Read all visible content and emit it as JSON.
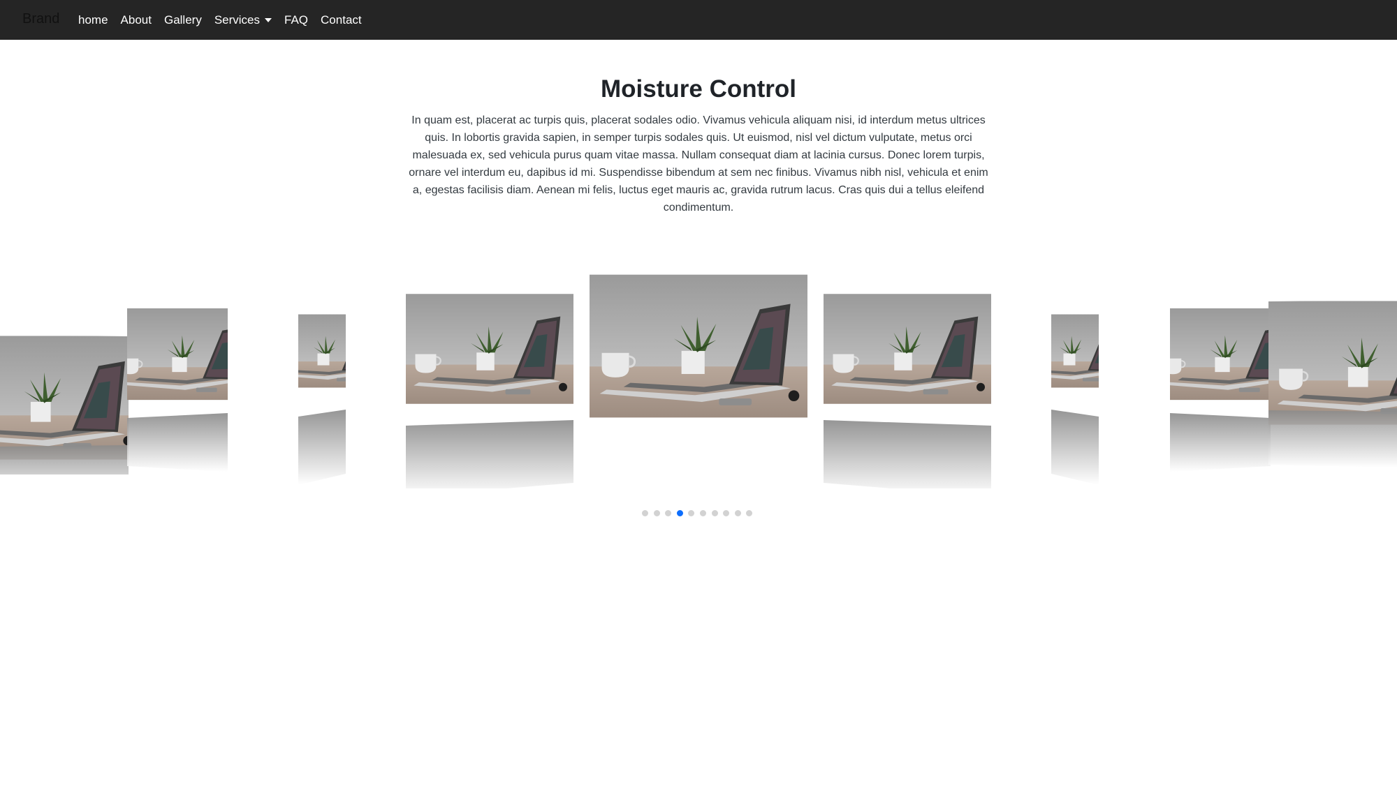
{
  "navbar": {
    "brand": "Brand",
    "links": [
      {
        "label": "home"
      },
      {
        "label": "About"
      },
      {
        "label": "Gallery"
      },
      {
        "label": "Services",
        "dropdown": true
      },
      {
        "label": "FAQ"
      },
      {
        "label": "Contact"
      }
    ]
  },
  "hero": {
    "title": "Moisture Control",
    "text": "In quam est, placerat ac turpis quis, placerat sodales odio. Vivamus vehicula aliquam nisi, id interdum metus ultrices quis. In lobortis gravida sapien, in semper turpis sodales quis. Ut euismod, nisl vel dictum vulputate, metus orci malesuada ex, sed vehicula purus quam vitae massa. Nullam consequat diam at lacinia cursus. Donec lorem turpis, ornare vel interdum eu, dapibus id mi. Suspendisse bibendum at sem nec finibus. Vivamus nibh nisl, vehicula et enim a, egestas facilisis diam. Aenean mi felis, luctus eget mauris ac, gravida rutrum lacus. Cras quis dui a tellus eleifend condimentum."
  },
  "carousel": {
    "slide_count": 10,
    "active_index": 3,
    "image_subject": "laptop-on-desk-photo"
  },
  "colors": {
    "navbar_bg": "#252525",
    "dot_active": "#0d6efd",
    "dot_inactive": "#d2d2d2"
  }
}
